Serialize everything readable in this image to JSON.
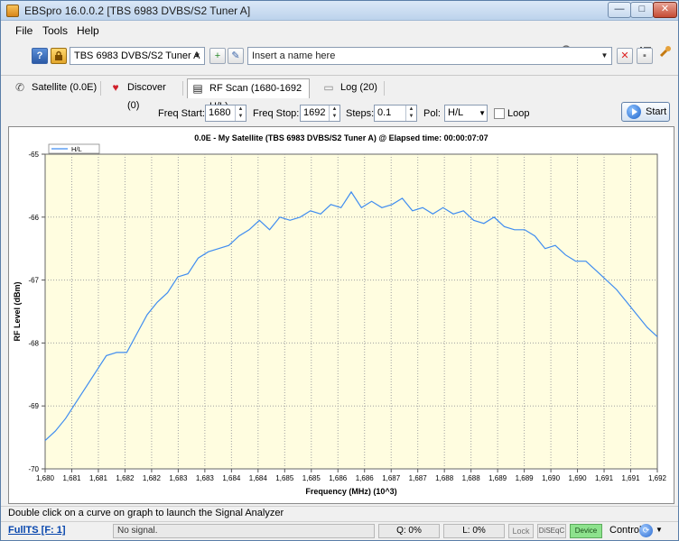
{
  "window": {
    "title": "EBSpro 16.0.0.2 [TBS 6983 DVBS/S2 Tuner A]",
    "minimize": "—",
    "maximize": "□",
    "close": "✕"
  },
  "menu": {
    "file": "File",
    "tools": "Tools",
    "help": "Help"
  },
  "toolbar_icons": [
    "search-icon",
    "satellite-dish-icon",
    "bar-chart-icon",
    "record-icon",
    "list-icon",
    "tools-icon"
  ],
  "toolbar": {
    "help_label": "?",
    "tuner_selected": "TBS 6983 DVBS/S2 Tuner A",
    "name_placeholder": "Insert a name here",
    "new_label": "+",
    "edit_label": "✎",
    "delete_label": "✕",
    "save_label": "▪"
  },
  "tabs": [
    {
      "label": "Satellite (0.0E)",
      "icon": "✆"
    },
    {
      "label": "Discover (0)",
      "icon": "♥"
    },
    {
      "label": "RF Scan (1680-1692 H/L)",
      "icon": "▤"
    },
    {
      "label": "Log (20)",
      "icon": "▭"
    }
  ],
  "params": {
    "freq_start_label": "Freq Start:",
    "freq_start_value": "1680",
    "freq_stop_label": "Freq Stop:",
    "freq_stop_value": "1692",
    "steps_label": "Steps:",
    "steps_value": "0.1",
    "pol_label": "Pol:",
    "pol_value": "H/L",
    "loop_label": "Loop",
    "loop_checked": false,
    "start_label": "Start"
  },
  "chart_data": {
    "type": "line",
    "title": "0.0E - My Satellite (TBS 6983 DVBS/S2 Tuner A) @ Elapsed time: 00:00:07:07",
    "xlabel": "Frequency (MHz) (10^3)",
    "ylabel": "RF Level (dBm)",
    "xlim": [
      1680,
      1692
    ],
    "ylim": [
      -70,
      -65
    ],
    "x_ticks": [
      "1,680",
      "1,681",
      "1,681",
      "1,682",
      "1,682",
      "1,683",
      "1,683",
      "1,684",
      "1,684",
      "1,685",
      "1,685",
      "1,686",
      "1,686",
      "1,687",
      "1,687",
      "1,688",
      "1,688",
      "1,689",
      "1,689",
      "1,690",
      "1,690",
      "1,691",
      "1,691",
      "1,692"
    ],
    "y_ticks": [
      "-65",
      "-66",
      "-67",
      "-68",
      "-69",
      "-70"
    ],
    "grid": true,
    "legend_position": "top-left",
    "line_color": "#3f8cf0",
    "plot_bg": "#fffde0",
    "series": [
      {
        "name": "H/L",
        "x": [
          1680.0,
          1680.2,
          1680.4,
          1680.6,
          1680.8,
          1681.0,
          1681.2,
          1681.4,
          1681.6,
          1681.8,
          1682.0,
          1682.2,
          1682.4,
          1682.6,
          1682.8,
          1683.0,
          1683.2,
          1683.4,
          1683.6,
          1683.8,
          1684.0,
          1684.2,
          1684.4,
          1684.6,
          1684.8,
          1685.0,
          1685.2,
          1685.4,
          1685.6,
          1685.8,
          1686.0,
          1686.2,
          1686.4,
          1686.6,
          1686.8,
          1687.0,
          1687.2,
          1687.4,
          1687.6,
          1687.8,
          1688.0,
          1688.2,
          1688.4,
          1688.6,
          1688.8,
          1689.0,
          1689.2,
          1689.4,
          1689.6,
          1689.8,
          1690.0,
          1690.2,
          1690.4,
          1690.6,
          1690.8,
          1691.0,
          1691.2,
          1691.4,
          1691.6,
          1691.8,
          1692.0
        ],
        "values": [
          -69.55,
          -69.4,
          -69.2,
          -68.95,
          -68.7,
          -68.45,
          -68.2,
          -68.15,
          -68.15,
          -67.85,
          -67.55,
          -67.35,
          -67.2,
          -66.95,
          -66.9,
          -66.65,
          -66.55,
          -66.5,
          -66.45,
          -66.3,
          -66.2,
          -66.05,
          -66.2,
          -66.0,
          -66.05,
          -66.0,
          -65.9,
          -65.95,
          -65.8,
          -65.85,
          -65.6,
          -65.85,
          -65.75,
          -65.85,
          -65.8,
          -65.7,
          -65.9,
          -65.85,
          -65.95,
          -65.85,
          -65.95,
          -65.9,
          -66.05,
          -66.1,
          -66.0,
          -66.15,
          -66.2,
          -66.2,
          -66.3,
          -66.5,
          -66.45,
          -66.6,
          -66.7,
          -66.7,
          -66.85,
          -67.0,
          -67.15,
          -67.35,
          -67.55,
          -67.75,
          -67.9
        ]
      }
    ]
  },
  "hint": "Double click on a curve on graph to launch the Signal Analyzer",
  "status": {
    "fullts": "FullTS [F: 1]",
    "signal": "No signal.",
    "quality": "Q: 0%",
    "level": "L: 0%",
    "lock": "Lock",
    "diseqc": "DiSEqC",
    "device": "Device",
    "control": "Control"
  }
}
